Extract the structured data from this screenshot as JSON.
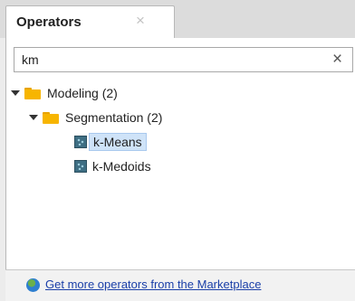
{
  "tab": {
    "title": "Operators",
    "close_glyph": "×"
  },
  "search": {
    "value": "km",
    "placeholder": "",
    "clear_glyph": "×"
  },
  "tree": {
    "modeling_label": "Modeling (2)",
    "segmentation_label": "Segmentation (2)",
    "operators": [
      {
        "label": "k-Means",
        "selected": true
      },
      {
        "label": "k-Medoids",
        "selected": false
      }
    ]
  },
  "footer": {
    "marketplace_link": "Get more operators from the Marketplace"
  },
  "colors": {
    "selection": "#cfe3f8",
    "folder": "#f7b500",
    "link": "#1a3fa8"
  },
  "icons": {
    "tab_close": "close-icon",
    "search_clear": "clear-icon",
    "folder": "folder-icon",
    "operator": "operator-icon",
    "marketplace": "globe-icon"
  }
}
